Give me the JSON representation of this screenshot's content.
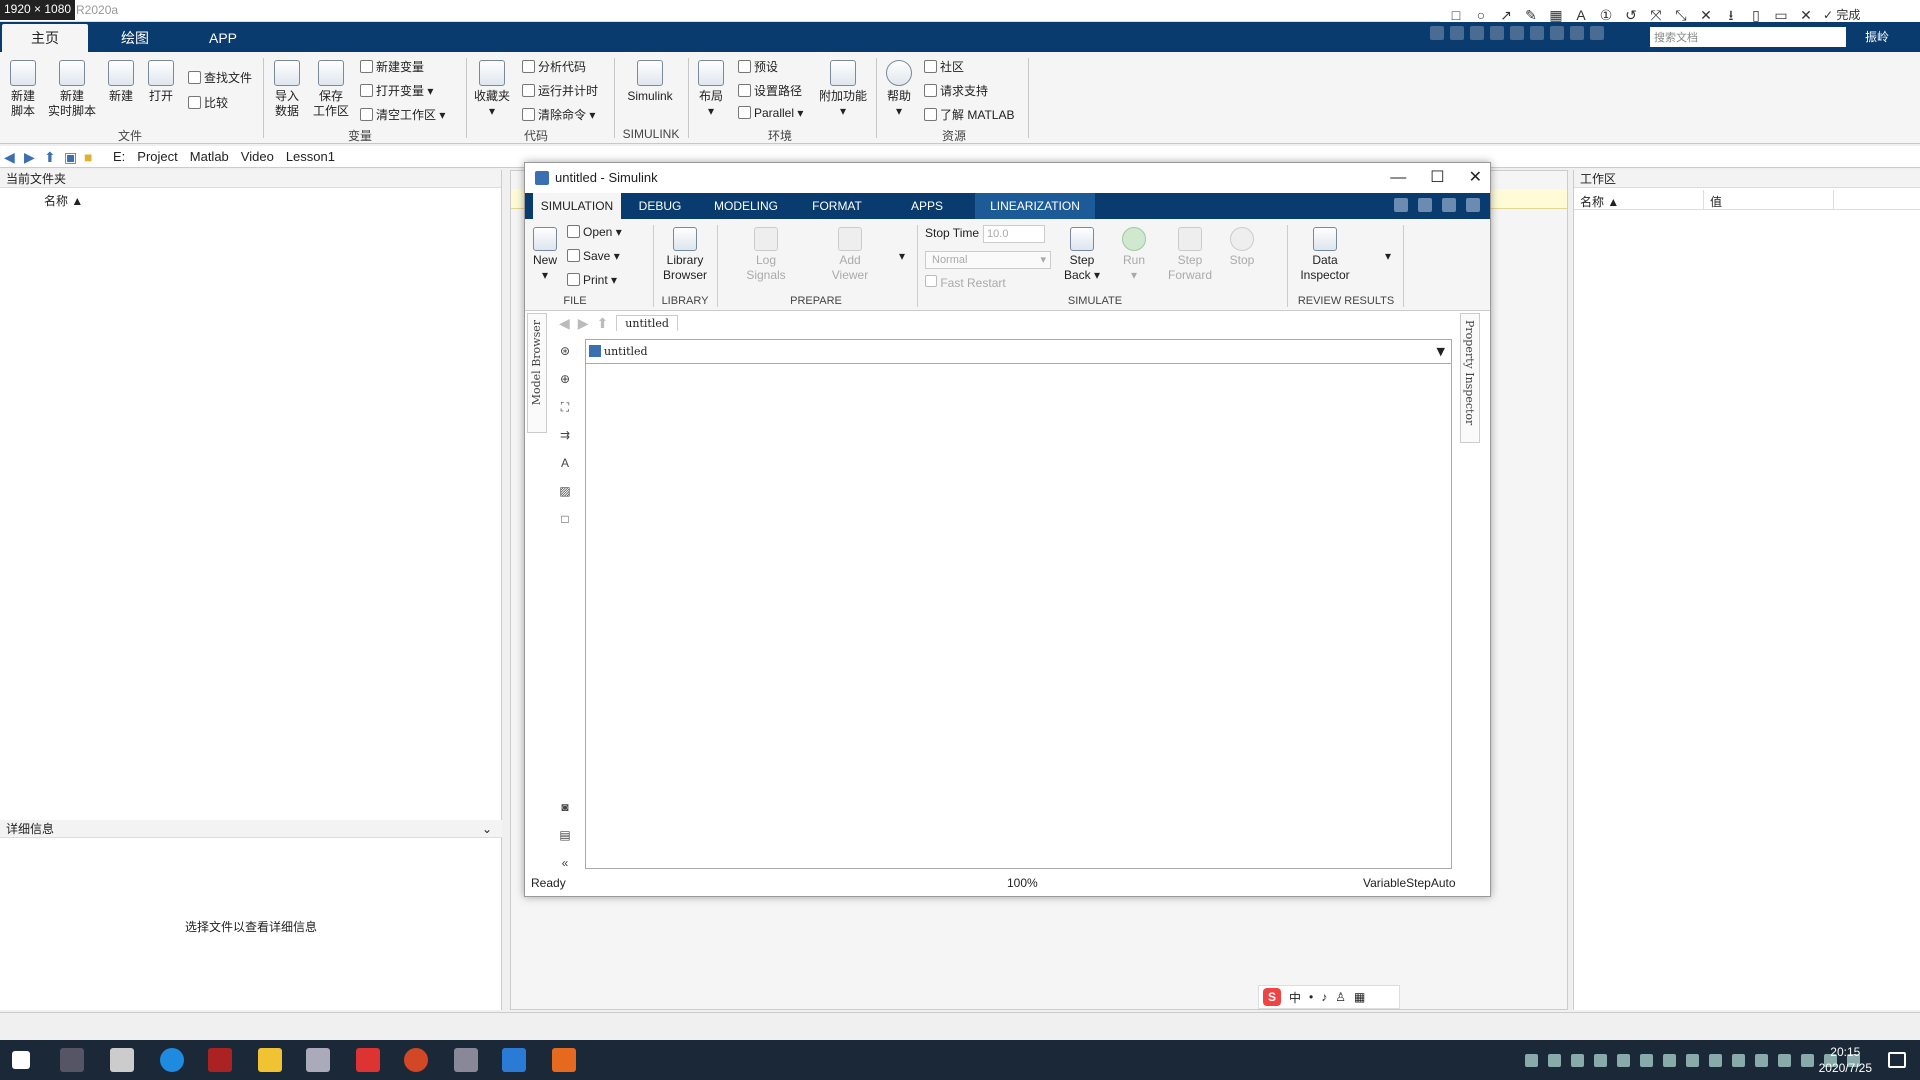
{
  "window": {
    "dims": "1920 × 1080",
    "app_title": "R2020a"
  },
  "annot_toolbar": {
    "done_label": "✓ 完成"
  },
  "main_tabs": [
    {
      "label": "主页"
    },
    {
      "label": "绘图"
    },
    {
      "label": "APP"
    }
  ],
  "top_search": {
    "placeholder": "搜索文档"
  },
  "user": {
    "label": "振岭"
  },
  "ribbon": {
    "file": {
      "new_script": "新建\n脚本",
      "new_live_script": "新建\n实时脚本",
      "new": "新建",
      "open": "打开",
      "find_files": "查找文件",
      "compare": "比较",
      "group": "文件"
    },
    "variable": {
      "import": "导入\n数据",
      "save_ws": "保存\n工作区",
      "new_var": "新建变量",
      "open_var": "打开变量",
      "clear_ws": "清空工作区",
      "group": "变量"
    },
    "code": {
      "favorites": "收藏夹",
      "analyze": "分析代码",
      "run_time": "运行并计时",
      "clear_cmd": "清除命令",
      "group": "代码"
    },
    "simulink": {
      "simulink": "Simulink",
      "group": "SIMULINK"
    },
    "env": {
      "layout": "布局",
      "prefs": "预设",
      "set_path": "设置路径",
      "parallel": "Parallel",
      "addons": "附加功能",
      "group": "环境"
    },
    "resources": {
      "help": "帮助",
      "community": "社区",
      "support": "请求支持",
      "learn": "了解 MATLAB",
      "group": "资源"
    }
  },
  "address": {
    "crumbs": [
      "E:",
      "Project",
      "Matlab",
      "Video",
      "Lesson1"
    ]
  },
  "left_pane": {
    "title": "当前文件夹",
    "col_name": "名称",
    "details_title": "详细信息",
    "details_msg": "选择文件以查看详细信息"
  },
  "workspace": {
    "title": "工作区",
    "col_name": "名称",
    "col_value": "值"
  },
  "simulink": {
    "title": "untitled - Simulink",
    "tabs": [
      "SIMULATION",
      "DEBUG",
      "MODELING",
      "FORMAT",
      "APPS",
      "LINEARIZATION"
    ],
    "file": {
      "new": "New",
      "open": "Open",
      "save": "Save",
      "print": "Print",
      "group": "FILE"
    },
    "library": {
      "browser": "Library\nBrowser",
      "group": "LIBRARY"
    },
    "prepare": {
      "log": "Log\nSignals",
      "add_viewer": "Add\nViewer",
      "group": "PREPARE"
    },
    "simulate": {
      "stop_time_label": "Stop Time",
      "stop_time": "10.0",
      "mode": "Normal",
      "fast_restart": "Fast Restart",
      "step_back": "Step\nBack",
      "run": "Run",
      "step_fwd": "Step\nForward",
      "stop": "Stop",
      "group": "SIMULATE"
    },
    "review": {
      "data_inspector": "Data\nInspector",
      "group": "REVIEW RESULTS"
    },
    "model_browser": "Model Browser",
    "property_inspector": "Property Inspector",
    "model_tab": "untitled",
    "crumb": "untitled",
    "status": {
      "ready": "Ready",
      "zoom": "100%",
      "solver": "VariableStepAuto"
    }
  },
  "taskbar": {
    "time": "20:15",
    "date": "2020/7/25"
  }
}
